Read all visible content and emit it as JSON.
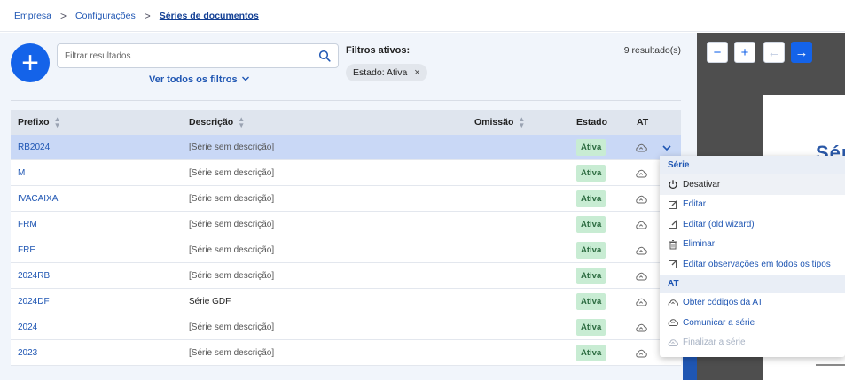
{
  "breadcrumb": {
    "items": [
      "Empresa",
      "Configurações",
      "Séries de documentos"
    ],
    "separator": ">"
  },
  "toolbar": {
    "add_label": "+",
    "search_placeholder": "Filtrar resultados",
    "all_filters_label": "Ver todos os filtros",
    "active_filters_title": "Filtros ativos:",
    "active_filter_chip": "Estado: Ativa",
    "chip_remove": "×",
    "results_count": "9 resultado(s)"
  },
  "table": {
    "columns": {
      "prefix": "Prefixo",
      "description": "Descrição",
      "omission": "Omissão",
      "status": "Estado",
      "at": "AT"
    },
    "rows": [
      {
        "prefix": "RB2024",
        "description": "[Série sem descrição]",
        "status": "Ativa"
      },
      {
        "prefix": "M",
        "description": "[Série sem descrição]",
        "status": "Ativa"
      },
      {
        "prefix": "IVACAIXA",
        "description": "[Série sem descrição]",
        "status": "Ativa"
      },
      {
        "prefix": "FRM",
        "description": "[Série sem descrição]",
        "status": "Ativa"
      },
      {
        "prefix": "FRE",
        "description": "[Série sem descrição]",
        "status": "Ativa"
      },
      {
        "prefix": "2024RB",
        "description": "[Série sem descrição]",
        "status": "Ativa"
      },
      {
        "prefix": "2024DF",
        "description": "Série GDF",
        "status": "Ativa"
      },
      {
        "prefix": "2024",
        "description": "[Série sem descrição]",
        "status": "Ativa"
      },
      {
        "prefix": "2023",
        "description": "[Série sem descrição]",
        "status": "Ativa"
      }
    ]
  },
  "menu": {
    "section_serie": "Série",
    "deactivate": "Desativar",
    "edit": "Editar",
    "edit_old": "Editar (old wizard)",
    "delete": "Eliminar",
    "edit_notes": "Editar observações em todos os tipos",
    "section_at": "AT",
    "get_codes": "Obter códigos da AT",
    "communicate": "Comunicar a série",
    "finalize": "Finalizar a série"
  },
  "preview": {
    "zoom_out": "−",
    "zoom_in": "+",
    "prev": "←",
    "next": "→",
    "doc_text": "Sér"
  },
  "colors": {
    "accent": "#1463e9",
    "badge_bg": "#c8ecd3",
    "selected_row": "#c9d8f6"
  }
}
